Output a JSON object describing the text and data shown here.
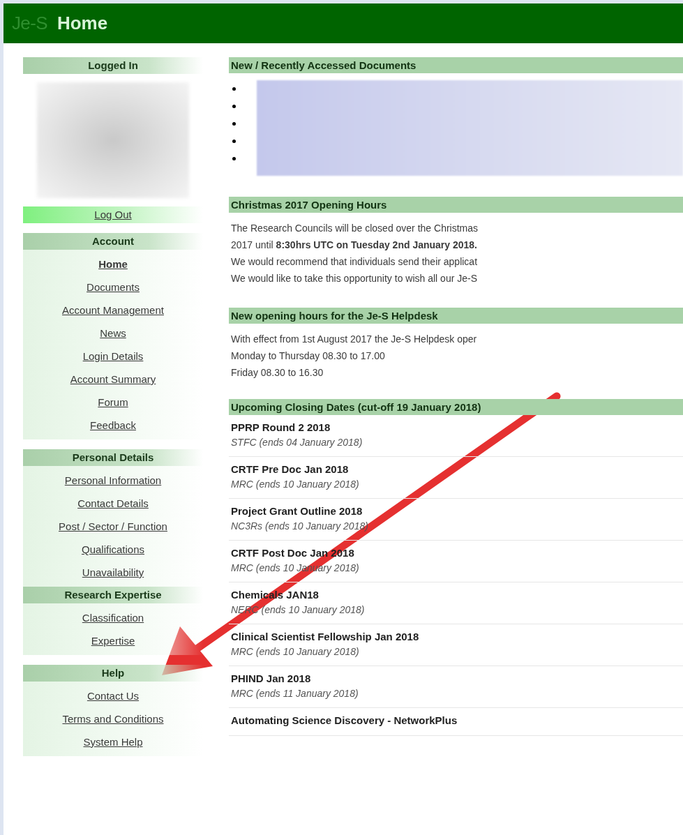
{
  "header": {
    "logo": "Je-S",
    "title": "Home"
  },
  "sidebar": {
    "sections": [
      {
        "kind": "user",
        "heading": "Logged In",
        "items": [
          {
            "label": "Log Out",
            "selected": false
          }
        ]
      },
      {
        "kind": "links",
        "heading": "Account",
        "items": [
          {
            "label": "Home",
            "selected": true
          },
          {
            "label": "Documents",
            "selected": false
          },
          {
            "label": "Account Management",
            "selected": false
          },
          {
            "label": "News",
            "selected": false
          },
          {
            "label": "Login Details",
            "selected": false
          },
          {
            "label": "Account Summary",
            "selected": false
          },
          {
            "label": "Forum",
            "selected": false
          },
          {
            "label": "Feedback",
            "selected": false
          }
        ]
      },
      {
        "kind": "links",
        "heading": "Personal Details",
        "items": [
          {
            "label": "Personal Information",
            "selected": false
          },
          {
            "label": "Contact Details",
            "selected": false
          },
          {
            "label": "Post / Sector / Function",
            "selected": false
          },
          {
            "label": "Qualifications",
            "selected": false
          },
          {
            "label": "Unavailability",
            "selected": false
          }
        ]
      },
      {
        "kind": "attached",
        "heading": "Research Expertise",
        "items": [
          {
            "label": "Classification",
            "selected": false
          },
          {
            "label": "Expertise",
            "selected": false
          }
        ]
      },
      {
        "kind": "links",
        "heading": "Help",
        "items": [
          {
            "label": "Contact Us",
            "selected": false
          },
          {
            "label": "Terms and Conditions",
            "selected": false
          },
          {
            "label": "System Help",
            "selected": false
          }
        ]
      }
    ]
  },
  "main": {
    "documents": {
      "heading": "New / Recently Accessed Documents",
      "items": [
        {
          "kind": "redacted"
        },
        {
          "kind": "redacted"
        },
        {
          "kind": "redacted"
        },
        {
          "kind": "redacted"
        },
        {
          "kind": "redacted"
        }
      ]
    },
    "notices": [
      {
        "heading": "Christmas 2017 Opening Hours",
        "lines": [
          "The Research Councils will be closed over the Christmas",
          "2017 until **8:30hrs UTC on Tuesday 2nd January 2018.**",
          "We would recommend that individuals send their applicat",
          "We would like to take this opportunity to wish all our Je-S"
        ]
      },
      {
        "heading": "New opening hours for the Je-S Helpdesk",
        "lines": [
          "With effect from 1st August 2017 the Je-S Helpdesk oper",
          "Monday to Thursday 08.30 to 17.00",
          "Friday 08.30 to 16.30"
        ]
      }
    ],
    "closing": {
      "heading": "Upcoming Closing Dates (cut-off 19 January 2018)",
      "items": [
        {
          "title": "PPRP Round 2 2018",
          "subtitle": "STFC (ends 04 January 2018)"
        },
        {
          "title": "CRTF Pre Doc Jan 2018",
          "subtitle": "MRC (ends 10 January 2018)"
        },
        {
          "title": "Project Grant Outline 2018",
          "subtitle": "NC3Rs (ends 10 January 2018)"
        },
        {
          "title": "CRTF Post Doc Jan 2018",
          "subtitle": "MRC (ends 10 January 2018)"
        },
        {
          "title": "Chemicals JAN18",
          "subtitle": "NERC (ends 10 January 2018)"
        },
        {
          "title": "Clinical Scientist Fellowship Jan 2018",
          "subtitle": "MRC (ends 10 January 2018)"
        },
        {
          "title": "PHIND Jan 2018",
          "subtitle": "MRC (ends 11 January 2018)"
        },
        {
          "title": "Automating Science Discovery - NetworkPlus"
        }
      ]
    }
  }
}
